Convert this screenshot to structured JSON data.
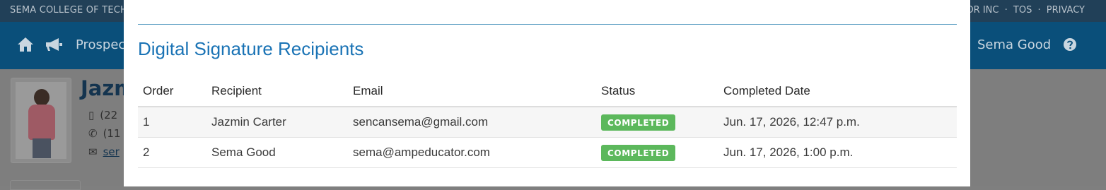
{
  "background": {
    "topbar": {
      "left_text": "SEMA COLLEGE OF TECH",
      "right_items": [
        "OR INC",
        "·",
        "TOS",
        "·",
        "PRIVACY"
      ]
    },
    "navbar": {
      "prospects_label": "Prospec",
      "user_name": "Sema Good",
      "icons": [
        "home-icon",
        "megaphone-icon",
        "help-icon"
      ]
    },
    "profile": {
      "name": "Jazm",
      "mobile": "(22",
      "phone": "(11",
      "email": "ser"
    }
  },
  "modal": {
    "title": "Digital Signature Recipients",
    "columns": [
      "Order",
      "Recipient",
      "Email",
      "Status",
      "Completed Date"
    ],
    "rows": [
      {
        "order": "1",
        "recipient": "Jazmin Carter",
        "email": "sencansema@gmail.com",
        "status": "COMPLETED",
        "completed_date": "Jun. 17, 2026, 12:47 p.m."
      },
      {
        "order": "2",
        "recipient": "Sema Good",
        "email": "sema@ampeducator.com",
        "status": "COMPLETED",
        "completed_date": "Jun. 17, 2026, 1:00 p.m."
      }
    ],
    "colors": {
      "title": "#1a73b5",
      "status_completed": "#5cb85c",
      "rule": "#5fa0c4"
    }
  }
}
